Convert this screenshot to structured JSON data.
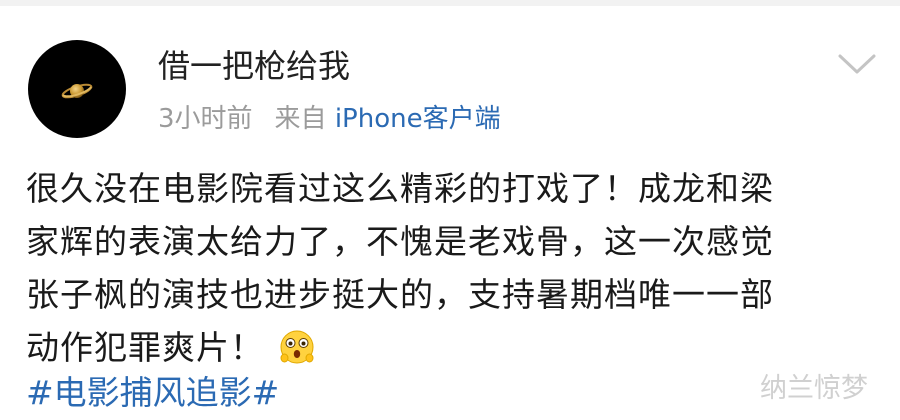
{
  "user": {
    "name": "借一把枪给我",
    "time": "3小时前",
    "source_prefix": "来自",
    "client": "iPhone客户端"
  },
  "post": {
    "lines": [
      "很久没在电影院看过这么精彩的打戏了！成龙和梁",
      "家辉的表演太给力了，不愧是老戏骨，这一次感觉",
      "张子枫的演技也进步挺大的，支持暑期档唯一一部",
      "动作犯罪爽片！"
    ],
    "emoji": "surprised-face-emoji",
    "hashtag": "#电影捕风追影#"
  },
  "icons": {
    "avatar": "saturn-planet-icon",
    "menu": "chevron-down-icon"
  },
  "watermark": "纳兰惊梦",
  "colors": {
    "link": "#2b6ab3",
    "meta": "#9b9b9b",
    "text": "#1a1a1a",
    "avatar_bg": "#000000"
  }
}
